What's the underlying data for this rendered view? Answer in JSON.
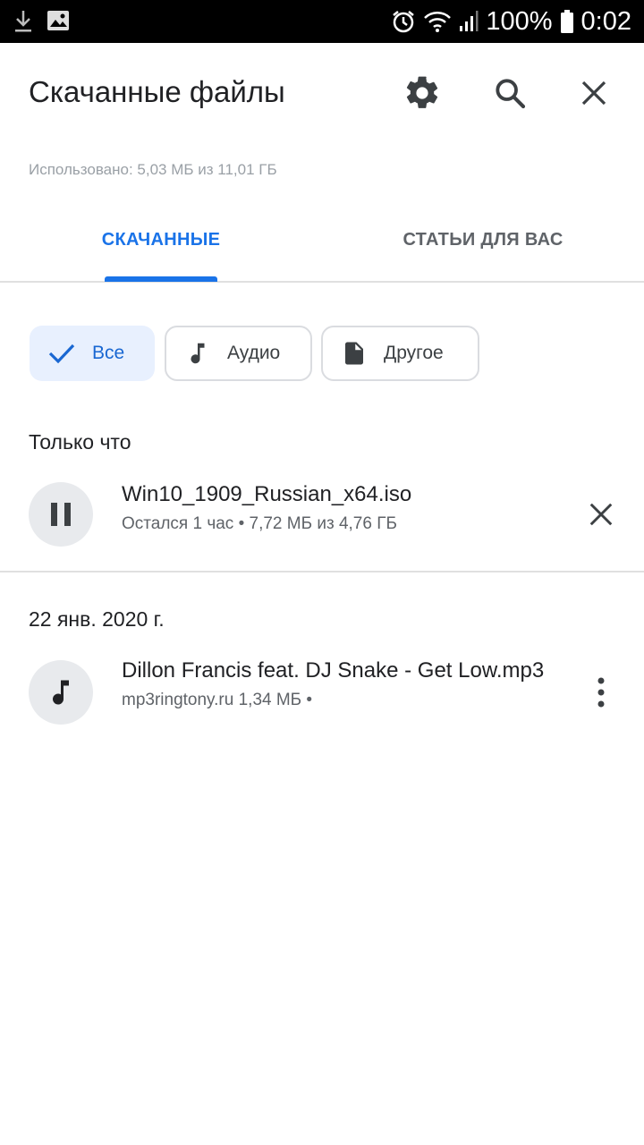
{
  "status_bar": {
    "battery": "100%",
    "time": "0:02",
    "icons": [
      "download-icon",
      "image-icon",
      "alarm-icon",
      "wifi-icon",
      "signal-icon",
      "battery-icon"
    ]
  },
  "header": {
    "title": "Скачанные файлы",
    "actions": [
      "settings-icon",
      "search-icon",
      "close-icon"
    ]
  },
  "storage": "Использовано: 5,03 МБ из 11,01 ГБ",
  "tabs": [
    {
      "label": "СКАЧАННЫЕ",
      "active": true
    },
    {
      "label": "СТАТЬИ ДЛЯ ВАС",
      "active": false
    }
  ],
  "filters": [
    {
      "label": "Все",
      "icon": "check-icon",
      "selected": true
    },
    {
      "label": "Аудио",
      "icon": "music-note-icon",
      "selected": false
    },
    {
      "label": "Другое",
      "icon": "document-icon",
      "selected": false
    }
  ],
  "sections": [
    {
      "header": "Только что",
      "items": [
        {
          "name": "Win10_1909_Russian_x64.iso",
          "meta": "Остался 1 час • 7,72 МБ из 4,76 ГБ",
          "icon": "pause-icon",
          "action_icon": "close-icon"
        }
      ]
    },
    {
      "header": "22 янв. 2020 г.",
      "items": [
        {
          "name": "Dillon Francis feat. DJ Snake - Get Low.mp3",
          "meta": "mp3ringtony.ru 1,34 МБ •",
          "icon": "music-note-icon",
          "action_icon": "more-vert-icon"
        }
      ]
    }
  ],
  "colors": {
    "accent": "#1a73e8",
    "chip_selected_bg": "#e8f0fe",
    "secondary_text": "#5f6368",
    "storage_text": "#9aa0a6",
    "avatar_bg": "#e8eaed"
  }
}
